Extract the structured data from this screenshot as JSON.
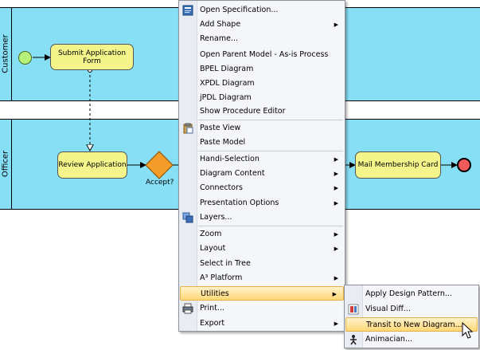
{
  "diagram": {
    "lanes": [
      {
        "label": "Customer"
      },
      {
        "label": "Officer"
      }
    ],
    "tasks": {
      "submit": "Submit Application Form",
      "review": "Review Application",
      "mail": "Mail Membership Card"
    },
    "gateway_label": "Accept?"
  },
  "context_menu": {
    "items": [
      {
        "label": "Open Specification...",
        "icon": "specification-icon"
      },
      {
        "label": "Add Shape",
        "submenu": true
      },
      {
        "label": "Rename..."
      },
      {
        "label": "Open Parent Model - As-is Process"
      },
      {
        "label": "BPEL Diagram"
      },
      {
        "label": "XPDL Diagram"
      },
      {
        "label": "jPDL Diagram"
      },
      {
        "label": "Show Procedure Editor"
      },
      {
        "label": "Paste View",
        "icon": "paste-icon"
      },
      {
        "label": "Paste Model"
      },
      {
        "label": "Handi-Selection",
        "submenu": true
      },
      {
        "label": "Diagram Content",
        "submenu": true
      },
      {
        "label": "Connectors",
        "submenu": true
      },
      {
        "label": "Presentation Options",
        "submenu": true
      },
      {
        "label": "Layers...",
        "icon": "layers-icon"
      },
      {
        "label": "Zoom",
        "submenu": true
      },
      {
        "label": "Layout",
        "submenu": true
      },
      {
        "label": "Select in Tree"
      },
      {
        "label": "A³ Platform",
        "submenu": true
      },
      {
        "label": "Utilities",
        "submenu": true,
        "highlighted": true
      },
      {
        "label": "Print...",
        "icon": "print-icon"
      },
      {
        "label": "Export",
        "submenu": true
      }
    ]
  },
  "submenu": {
    "items": [
      {
        "label": "Apply Design Pattern..."
      },
      {
        "label": "Visual Diff...",
        "icon": "visual-diff-icon"
      },
      {
        "label": "Transit to New Diagram...",
        "highlighted": true
      },
      {
        "label": "Animacian...",
        "icon": "animacian-icon"
      }
    ]
  },
  "colors": {
    "lane": "#87dff5",
    "task": "#f3f58a",
    "gateway": "#f39c2a",
    "start": "#b6f27a",
    "end": "#ee5a5a",
    "highlight": "#ffd776"
  }
}
